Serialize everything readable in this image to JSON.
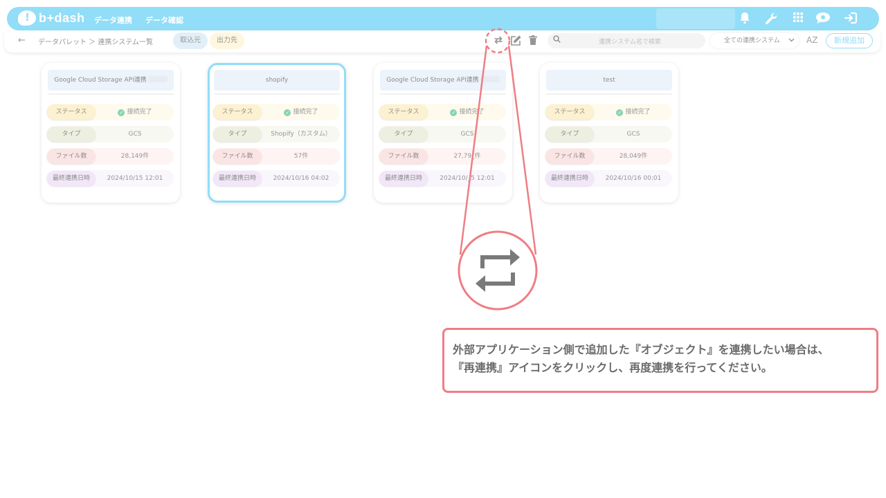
{
  "header": {
    "logo_text": "b+dash",
    "nav": [
      "データ連携",
      "データ確認"
    ]
  },
  "subbar": {
    "back_icon": "←",
    "breadcrumb": "データパレット ＞ 連携システム一覧",
    "tab_import": "取込元",
    "tab_export": "出力先",
    "search_placeholder": "連携システム名で検索",
    "filter_value": "全ての連携システム",
    "sort_label": "AZ",
    "new_button": "新規追加"
  },
  "cards": [
    {
      "title": "Google Cloud Storage API連携",
      "status_label": "ステータス",
      "status": "接続完了",
      "type_label": "タイプ",
      "type": "GCS",
      "files_label": "ファイル数",
      "files": "28,149件",
      "last_label": "最終連携日時",
      "last": "2024/10/15 12:01"
    },
    {
      "title": "shopify",
      "status_label": "ステータス",
      "status": "接続完了",
      "type_label": "タイプ",
      "type": "Shopify（カスタム）",
      "files_label": "ファイル数",
      "files": "57件",
      "last_label": "最終連携日時",
      "last": "2024/10/16 04:02"
    },
    {
      "title": "Google Cloud Storage API連携",
      "status_label": "ステータス",
      "status": "接続完了",
      "type_label": "タイプ",
      "type": "GCS",
      "files_label": "ファイル数",
      "files": "27,79_件",
      "last_label": "最終連携日時",
      "last": "2024/10/_5 12:01"
    },
    {
      "title": "test",
      "status_label": "ステータス",
      "status": "接続完了",
      "type_label": "タイプ",
      "type": "GCS",
      "files_label": "ファイル数",
      "files": "28,049件",
      "last_label": "最終連携日時",
      "last": "2024/10/16 00:01"
    }
  ],
  "note": {
    "line1": "外部アプリケーション側で追加した『オブジェクト』を連携したい場合は、",
    "line2": "『再連携』アイコンをクリックし、再度連携を行ってください。"
  },
  "colors": {
    "accent": "#4fc8f2",
    "callout": "#ef7d84"
  }
}
